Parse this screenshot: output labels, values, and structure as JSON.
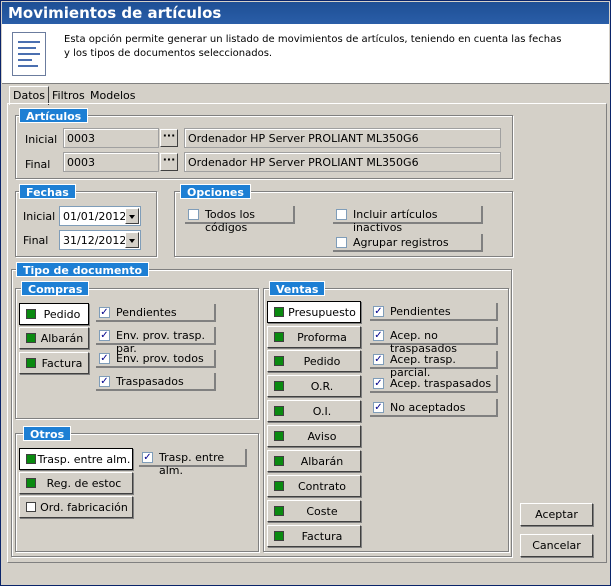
{
  "window": {
    "title": "Movimientos de artículos"
  },
  "info": {
    "icon": "document-list-icon",
    "text": "Esta opción permite generar un listado de movimientos de artículos, teniendo en cuenta las fechas y los tipos de documentos seleccionados."
  },
  "tabs": [
    "Datos",
    "Filtros",
    "Modelos"
  ],
  "articulos": {
    "legend": "Artículos",
    "inicial_label": "Inicial",
    "inicial_code": "0003",
    "inicial_desc": "Ordenador HP Server PROLIANT ML350G6",
    "final_label": "Final",
    "final_code": "0003",
    "final_desc": "Ordenador HP Server PROLIANT ML350G6",
    "browse": "···"
  },
  "fechas": {
    "legend": "Fechas",
    "inicial_label": "Inicial",
    "inicial": "01/01/2012",
    "final_label": "Final",
    "final": "31/12/2012"
  },
  "opciones": {
    "legend": "Opciones",
    "todos": "Todos los códigos",
    "incluir": "Incluir artículos inactivos",
    "agrupar": "Agrupar registros"
  },
  "tipo": {
    "legend": "Tipo de documento"
  },
  "compras": {
    "legend": "Compras",
    "buttons": [
      "Pedido",
      "Albarán",
      "Factura"
    ],
    "checks": [
      "Pendientes",
      "Env. prov. trasp. par.",
      "Env. prov. todos",
      "Traspasados"
    ]
  },
  "otros": {
    "legend": "Otros",
    "buttons": [
      "Trasp. entre alm.",
      "Reg. de estoc",
      "Ord. fabricación"
    ],
    "check": "Trasp. entre alm."
  },
  "ventas": {
    "legend": "Ventas",
    "buttons": [
      "Presupuesto",
      "Proforma",
      "Pedido",
      "O.R.",
      "O.I.",
      "Aviso",
      "Albarán",
      "Contrato",
      "Coste",
      "Factura"
    ],
    "checks": [
      "Pendientes",
      "Acep. no traspasados",
      "Acep. trasp. parcial.",
      "Acep. traspasados",
      "No aceptados"
    ]
  },
  "actions": {
    "accept": "Aceptar",
    "cancel": "Cancelar"
  },
  "check_mark": "✓"
}
